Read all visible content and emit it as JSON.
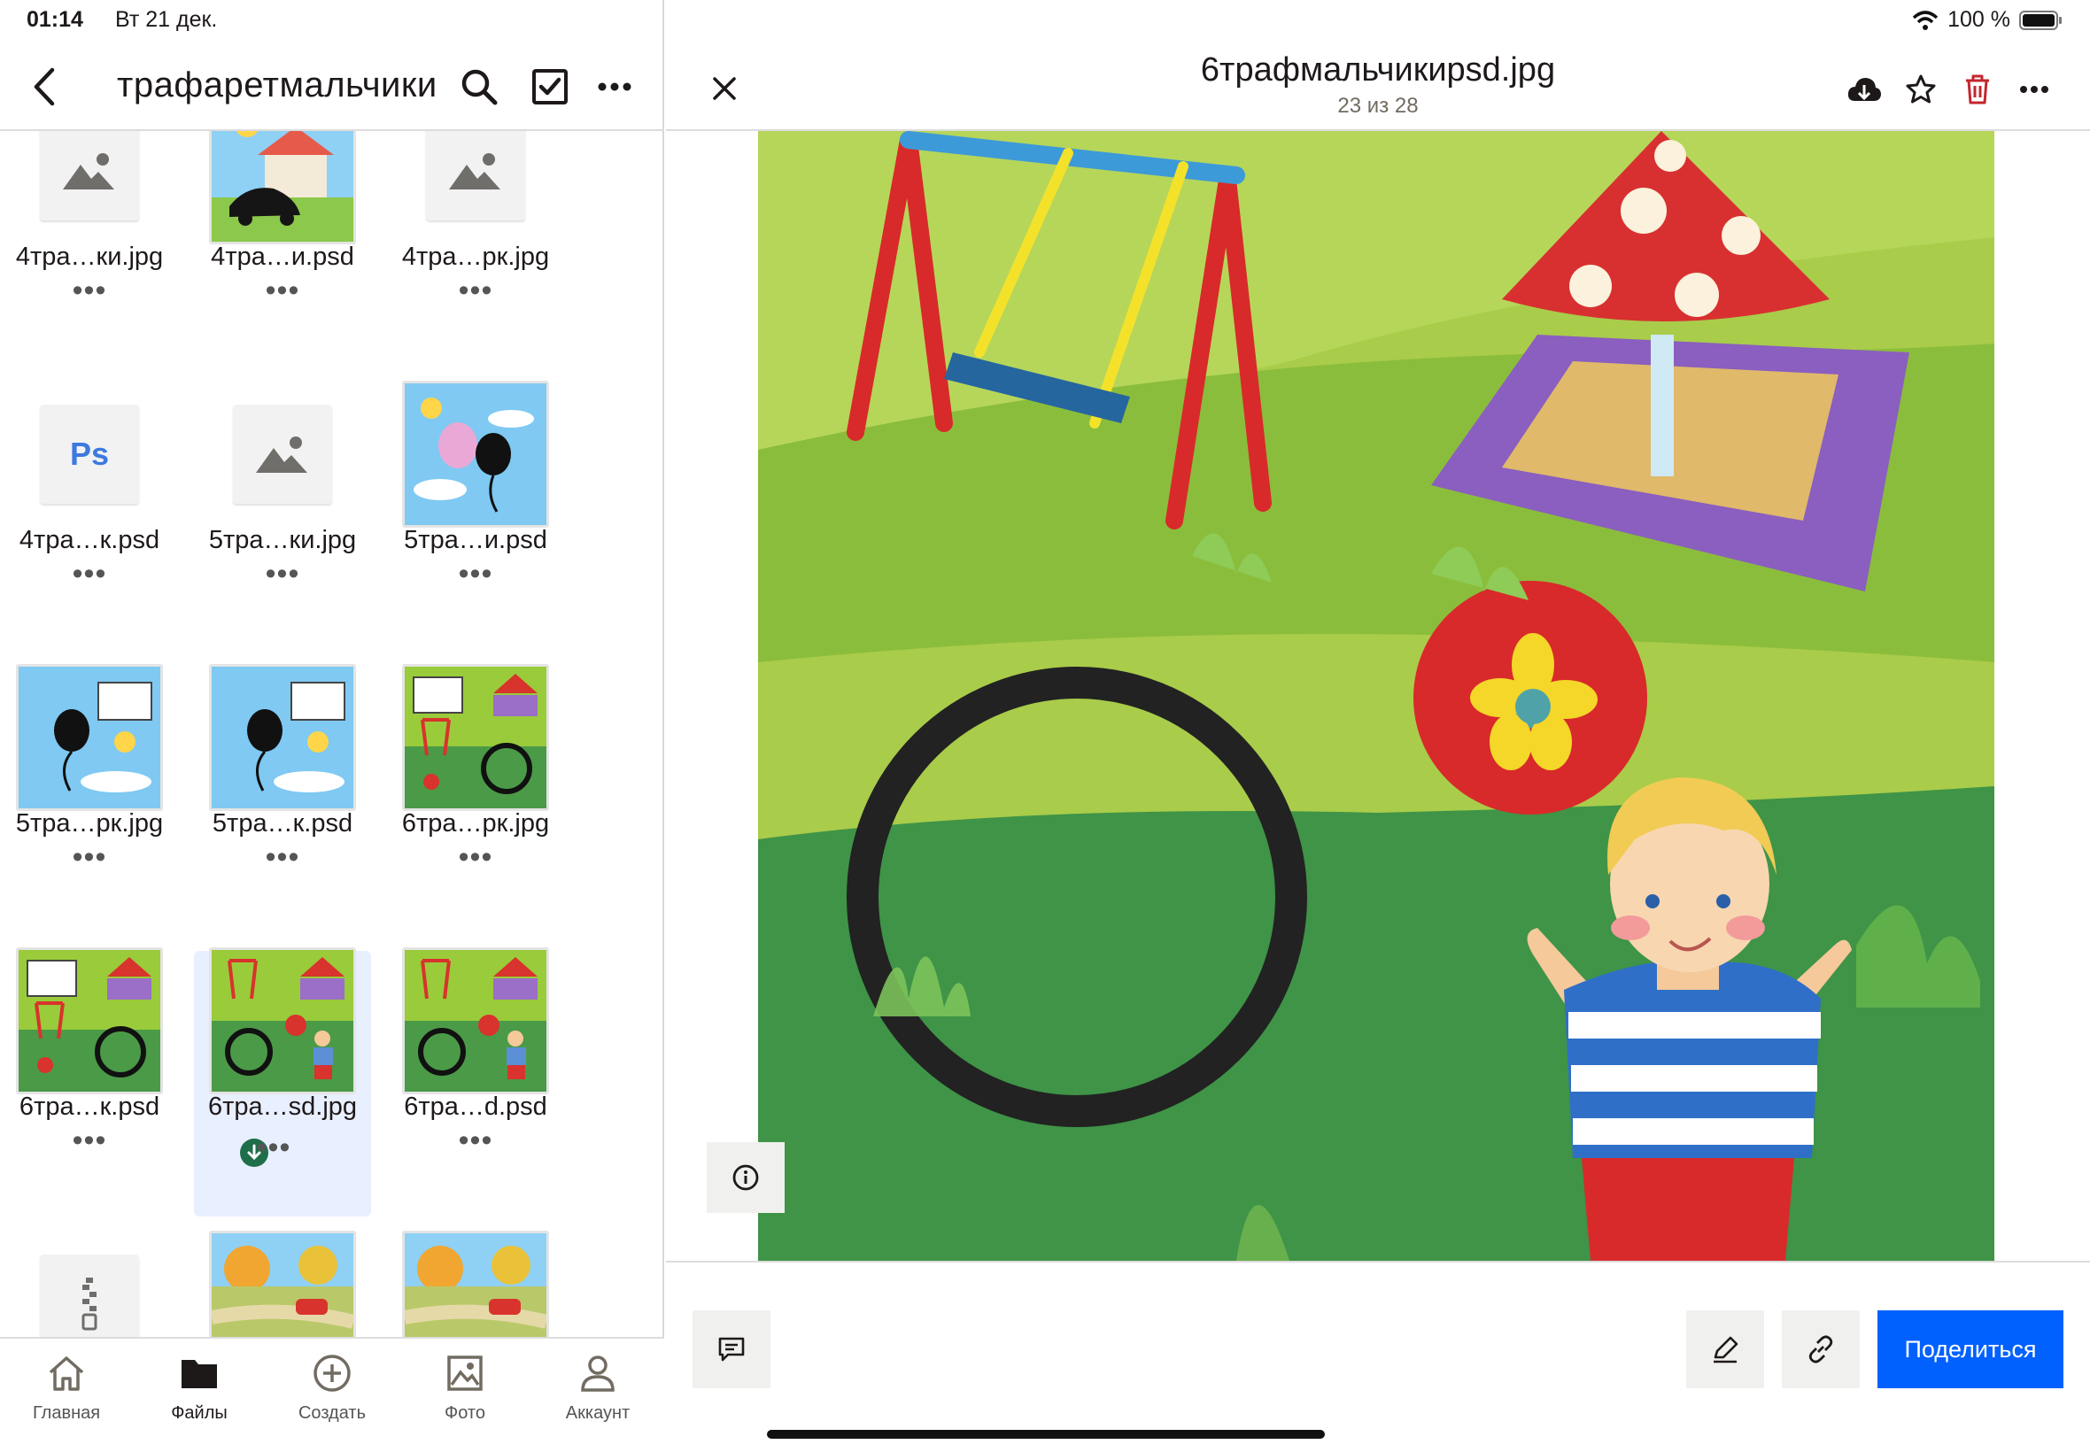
{
  "status_bar": {
    "time": "01:14",
    "date": "Вт 21 дек.",
    "battery": "100 %"
  },
  "left_header": {
    "title": "трафаретмальчики"
  },
  "files": [
    {
      "label": "4тра…ки.jpg",
      "thumb": "generic-image-icon"
    },
    {
      "label": "4тра…и.psd",
      "thumb": "house-car-preview"
    },
    {
      "label": "4тра…рк.jpg",
      "thumb": "generic-image-icon"
    },
    {
      "label": "4тра…к.psd",
      "thumb": "photoshop-icon",
      "ps_text": "Ps"
    },
    {
      "label": "5тра…ки.jpg",
      "thumb": "generic-image-icon"
    },
    {
      "label": "5тра…и.psd",
      "thumb": "balloon-preview"
    },
    {
      "label": "5тра…рк.jpg",
      "thumb": "balloon-sign-preview"
    },
    {
      "label": "5тра…к.psd",
      "thumb": "balloon-sign-preview"
    },
    {
      "label": "6тра…рк.jpg",
      "thumb": "playground-preview"
    },
    {
      "label": "6тра…к.psd",
      "thumb": "playground-preview"
    },
    {
      "label": "6тра…sd.jpg",
      "thumb": "playground-boy-preview",
      "selected": true
    },
    {
      "label": "6тра…d.psd",
      "thumb": "playground-boy-preview"
    },
    {
      "label": "",
      "thumb": "zip-icon"
    },
    {
      "label": "",
      "thumb": "road-preview"
    },
    {
      "label": "",
      "thumb": "road-preview"
    }
  ],
  "more_glyph": "•••",
  "tabs": [
    {
      "label": "Главная",
      "icon": "home-icon"
    },
    {
      "label": "Файлы",
      "icon": "folder-icon",
      "active": true
    },
    {
      "label": "Создать",
      "icon": "plus-circle-icon"
    },
    {
      "label": "Фото",
      "icon": "photo-icon"
    },
    {
      "label": "Аккаунт",
      "icon": "person-icon"
    }
  ],
  "viewer": {
    "title": "6трафмальчикиpsd.jpg",
    "position": "23 из 28",
    "share_label": "Поделиться"
  },
  "colors": {
    "accent": "#0061fe",
    "selected_tile": "#e8efff",
    "delete": "#c4262e"
  }
}
